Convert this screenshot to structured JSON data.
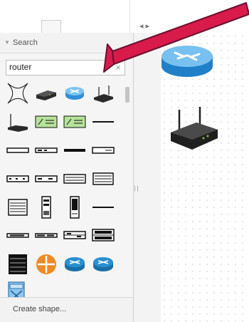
{
  "sidebar": {
    "section_title": "Search",
    "search": {
      "value": "router"
    },
    "shape_icons": [
      "net-x-shape-icon",
      "router-device-icon",
      "router-blue-icon",
      "wireless-router-icon",
      "access-point-icon",
      "green-switch-icon",
      "green-switch-icon-2",
      "line-device-icon",
      "rack-strip-icon",
      "patch-panel-icon",
      "cable-icon",
      "rack-unit-icon",
      "rack-router-icon",
      "rack-router-icon-2",
      "rack-panel-icon",
      "rack-shelf-icon",
      "server-rack-icon",
      "tower-server-icon",
      "tower-server-icon-2",
      "line-segment-icon",
      "rack-1u-icon",
      "rack-1u-icon-2",
      "rack-2u-icon",
      "rack-2u-icon-2",
      "black-server-icon",
      "orange-router-icon",
      "cisco-router-icon",
      "cisco-router-icon-2",
      "switch-crosspoint-icon"
    ],
    "footer_label": "Create shape..."
  },
  "canvas": {
    "items": [
      "router-blue-icon",
      "wireless-router-icon"
    ]
  },
  "annotation": {
    "arrow_color": "#d81b4a",
    "arrow_outline": "#6b1030"
  }
}
